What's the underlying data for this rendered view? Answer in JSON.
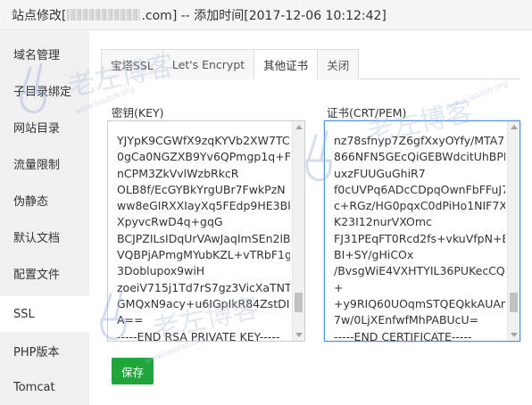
{
  "title": {
    "prefix": "站点修改[",
    "suffix": ".com] -- 添加时间[2017-12-06 10:12:42]"
  },
  "sidebar": {
    "items": [
      {
        "label": "域名管理"
      },
      {
        "label": "子目录绑定"
      },
      {
        "label": "网站目录"
      },
      {
        "label": "流量限制"
      },
      {
        "label": "伪静态"
      },
      {
        "label": "默认文档"
      },
      {
        "label": "配置文件"
      },
      {
        "label": "SSL"
      },
      {
        "label": "PHP版本"
      },
      {
        "label": "Tomcat"
      }
    ],
    "active_index": 7
  },
  "tabs": [
    {
      "label": "宝塔SSL"
    },
    {
      "label": "Let's Encrypt"
    },
    {
      "label": "其他证书"
    },
    {
      "label": "关闭"
    }
  ],
  "key_field": {
    "label": "密钥(KEY)",
    "lines": [
      "YJYpK9CGWfX9zqKYVb2XW7TC",
      "0gCa0NGZXB9Yv6QPmgp1q+F",
      "nCPM3ZkVvlWzbRkcR",
      "OLB8f/EcGYBkYrgUBr7FwkPzN",
      "ww8eGIRXXIayXq5FEdp9HE3Bk",
      "XpyvcRwD4q+gqG",
      "BCJPZILsIDqUrVAwJaqImSEn2lB",
      "VQBPjAPmgMYubKZL+vTRbF1g",
      "3Doblupox9wiH",
      "zoeiV715j1Td7rS7gz3VicXaTNT",
      "GMQxN9acy+u6IGpIkR84ZstDIr",
      "A==",
      "-----END RSA PRIVATE KEY-----"
    ]
  },
  "cert_field": {
    "label": "证书(CRT/PEM)",
    "lines": [
      "nz78sfnyp7Z6gfXxyOYfy/MTA7",
      "866NFN5GEcQiGEBWdcitUhBPL",
      "uxzFUUGuGhiR7",
      "f0cUVPq6ADcCDpqOwnFbFFuJ7",
      "c+RGz/HG0pqxC0dPiHo1NIF7X",
      "K23I12nurVXOmc",
      "FJ31PEqFT0Rcd2fs+vkuVfpN+E",
      "BI+SY/gHiCOx",
      "/BvsgWiE4VXHTYIL36PUKecCQ",
      "+",
      "+y9RIQ60UOqmSTQEQkkAUAn",
      "7w/0LjXEnfwfMhPABUcU=",
      "-----END CERTIFICATE-----"
    ]
  },
  "save_button": {
    "label": "保存",
    "color": "#20a53a"
  },
  "watermark": {
    "text": "老左博客",
    "url": "www.laozuo.org"
  }
}
